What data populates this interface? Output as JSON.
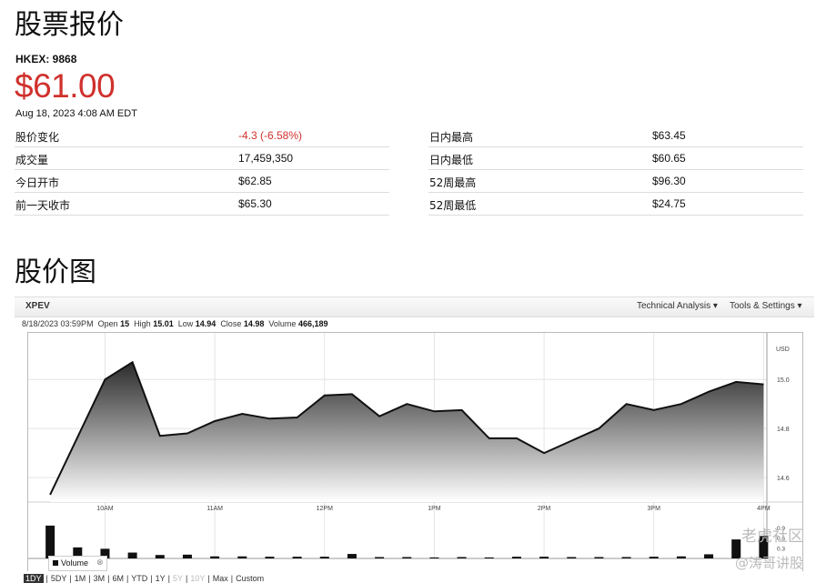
{
  "page": {
    "title": "股票报价",
    "chart_section_title": "股价图"
  },
  "quote": {
    "ticker": "HKEX: 9868",
    "price": "$61.00",
    "as_of": "Aug 18, 2023 4:08 AM EDT",
    "left_rows": [
      {
        "label": "股价变化",
        "value": "-4.3 (-6.58%)"
      },
      {
        "label": "成交量",
        "value": "17,459,350"
      },
      {
        "label": "今日开市",
        "value": "$62.85"
      },
      {
        "label": "前一天收市",
        "value": "$65.30"
      }
    ],
    "right_rows": [
      {
        "label": "日内最高",
        "value": "$63.45"
      },
      {
        "label": "日内最低",
        "value": "$60.65"
      },
      {
        "label": "52周最高",
        "value": "$96.30"
      },
      {
        "label": "52周最低",
        "value": "$24.75"
      }
    ],
    "negative_color": "#d0312d"
  },
  "chart_toolbar": {
    "symbol": "XPEV",
    "technical_analysis": "Technical Analysis ▾",
    "tools_settings": "Tools & Settings ▾"
  },
  "ohlc": {
    "datetime": "8/18/2023 03:59PM",
    "open_label": "Open",
    "open": "15",
    "high_label": "High",
    "high": "15.01",
    "low_label": "Low",
    "low": "14.94",
    "close_label": "Close",
    "close": "14.98",
    "volume_label": "Volume",
    "volume": "466,189"
  },
  "volume_legend": {
    "label": "Volume",
    "close": "⊗"
  },
  "ranges": [
    "1DY",
    "5DY",
    "1M",
    "3M",
    "6M",
    "YTD",
    "1Y",
    "5Y",
    "10Y",
    "Max",
    "Custom"
  ],
  "ranges_selected": "1DY",
  "ranges_disabled": [
    "5Y",
    "10Y"
  ],
  "watermark": {
    "line1": "老虎社区",
    "line2": "@涛哥讲股"
  },
  "chart_data": {
    "type": "area",
    "currency_label": "USD",
    "y_ticks": [
      "15.0",
      "14.8",
      "14.6"
    ],
    "ylim": [
      14.5,
      15.19
    ],
    "x_ticks": [
      "10AM",
      "11AM",
      "12PM",
      "1PM",
      "2PM",
      "3PM",
      "4PM"
    ],
    "x_tick_times": [
      10.0,
      11.0,
      12.0,
      13.0,
      14.0,
      15.0,
      16.0
    ],
    "xlim": [
      9.3,
      16.03
    ],
    "series": [
      {
        "x": [
          9.5,
          10.0,
          10.25,
          10.5,
          10.75,
          11.0,
          11.25,
          11.5,
          11.75,
          12.0,
          12.25,
          12.5,
          12.75,
          13.0,
          13.25,
          13.5,
          13.75,
          14.0,
          14.25,
          14.5,
          14.75,
          15.0,
          15.25,
          15.5,
          15.75,
          16.0
        ],
        "values": [
          14.53,
          15.0,
          15.07,
          14.77,
          14.78,
          14.83,
          14.86,
          14.84,
          14.845,
          14.935,
          14.94,
          14.85,
          14.9,
          14.87,
          14.875,
          14.76,
          14.76,
          14.7,
          14.75,
          14.8,
          14.9,
          14.875,
          14.9,
          14.95,
          14.99,
          14.98
        ]
      }
    ],
    "volume": {
      "y_ticks": [
        "0.9",
        "0.6",
        "0.3"
      ],
      "ylim": [
        0,
        1.0
      ],
      "x": [
        9.5,
        9.75,
        10.0,
        10.25,
        10.5,
        10.75,
        11.0,
        11.25,
        11.5,
        11.75,
        12.0,
        12.25,
        12.5,
        12.75,
        13.0,
        13.25,
        13.5,
        13.75,
        14.0,
        14.25,
        14.5,
        14.75,
        15.0,
        15.25,
        15.5,
        15.75,
        16.0
      ],
      "values": [
        0.95,
        0.32,
        0.28,
        0.17,
        0.1,
        0.11,
        0.06,
        0.06,
        0.05,
        0.05,
        0.05,
        0.13,
        0.04,
        0.04,
        0.03,
        0.04,
        0.03,
        0.05,
        0.05,
        0.04,
        0.04,
        0.04,
        0.05,
        0.06,
        0.12,
        0.55,
        0.65
      ]
    }
  }
}
